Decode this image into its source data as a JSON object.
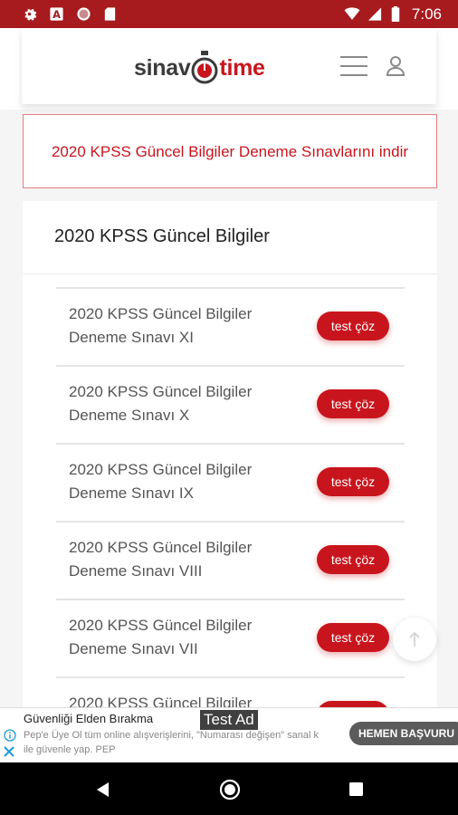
{
  "status_bar": {
    "time": "7:06",
    "left_icons": [
      "gear-icon",
      "a-letter-icon",
      "circle-icon",
      "sd-card-icon"
    ],
    "right_icons": [
      "wifi-icon",
      "signal-icon",
      "battery-icon"
    ]
  },
  "header": {
    "logo_part1": "sinav",
    "logo_part2": "time",
    "menu_icon": "hamburger-menu-icon",
    "user_icon": "user-icon"
  },
  "alert": {
    "text": "2020 KPSS Güncel Bilgiler Deneme Sınavlarını indir"
  },
  "card": {
    "title": "2020 KPSS Güncel Bilgiler",
    "items": [
      {
        "label": "2020 KPSS Güncel Bilgiler Deneme Sınavı XI",
        "button": "test çöz"
      },
      {
        "label": "2020 KPSS Güncel Bilgiler Deneme Sınavı X",
        "button": "test çöz"
      },
      {
        "label": "2020 KPSS Güncel Bilgiler Deneme Sınavı IX",
        "button": "test çöz"
      },
      {
        "label": "2020 KPSS Güncel Bilgiler Deneme Sınavı VIII",
        "button": "test çöz"
      },
      {
        "label": "2020 KPSS Güncel Bilgiler Deneme Sınavı VII",
        "button": "test çöz"
      },
      {
        "label": "2020 KPSS Güncel Bilgiler",
        "button": ""
      }
    ]
  },
  "ad": {
    "tag": "Test Ad",
    "title": "Güvenliği Elden Bırakma",
    "body_line1": "Pep'e Üye Ol tüm online alışverişlerini, \"Numarası değişen\" sanal k",
    "body_line2": "ile güvenle yap. PEP",
    "cta": "HEMEN BAŞVURU"
  },
  "colors": {
    "brand_red": "#c8151d",
    "status_bar": "#a71a1e"
  }
}
